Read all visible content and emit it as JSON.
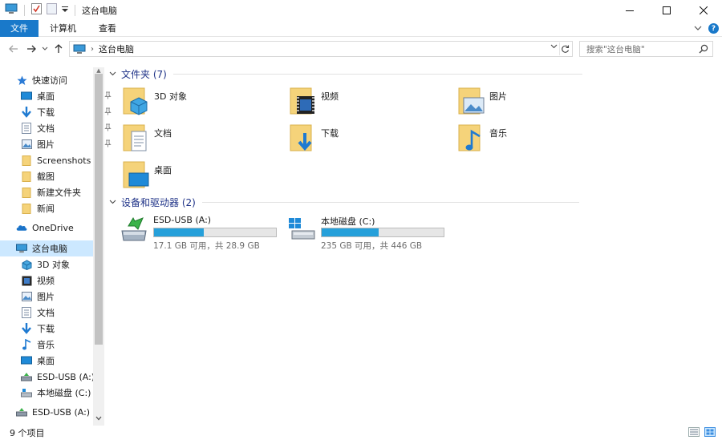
{
  "window": {
    "title": "这台电脑"
  },
  "ribbon": {
    "tabs": [
      "文件",
      "计算机",
      "查看"
    ],
    "help": "?"
  },
  "address": {
    "path": "这台电脑",
    "search_placeholder": "搜索\"这台电脑\""
  },
  "sidebar": {
    "quick_access": "快速访问",
    "items": [
      {
        "label": "桌面",
        "icon": "desktop-icon",
        "pinned": true
      },
      {
        "label": "下载",
        "icon": "download-icon",
        "pinned": true
      },
      {
        "label": "文档",
        "icon": "document-icon",
        "pinned": true
      },
      {
        "label": "图片",
        "icon": "picture-icon",
        "pinned": true
      },
      {
        "label": "Screenshots",
        "icon": "folder-icon",
        "pinned": false
      },
      {
        "label": "截图",
        "icon": "folder-icon",
        "pinned": false
      },
      {
        "label": "新建文件夹",
        "icon": "folder-icon",
        "pinned": false
      },
      {
        "label": "新闻",
        "icon": "folder-icon",
        "pinned": false
      }
    ],
    "onedrive": "OneDrive",
    "this_pc": "这台电脑",
    "pc_items": [
      {
        "label": "3D 对象",
        "icon": "3d-objects-icon"
      },
      {
        "label": "视频",
        "icon": "video-icon"
      },
      {
        "label": "图片",
        "icon": "picture-icon"
      },
      {
        "label": "文档",
        "icon": "document-icon"
      },
      {
        "label": "下载",
        "icon": "download-icon"
      },
      {
        "label": "音乐",
        "icon": "music-icon"
      },
      {
        "label": "桌面",
        "icon": "desktop-icon"
      },
      {
        "label": "ESD-USB (A:)",
        "icon": "usb-drive-icon"
      },
      {
        "label": "本地磁盘 (C:)",
        "icon": "local-disk-icon"
      }
    ],
    "usb_root": "ESD-USB (A:)"
  },
  "main": {
    "folders_header": "文件夹 (7)",
    "folders": [
      {
        "label": "3D 对象",
        "icon": "3d-objects-folder-icon"
      },
      {
        "label": "视频",
        "icon": "video-folder-icon"
      },
      {
        "label": "图片",
        "icon": "picture-folder-icon"
      },
      {
        "label": "文档",
        "icon": "document-folder-icon"
      },
      {
        "label": "下载",
        "icon": "download-folder-icon"
      },
      {
        "label": "音乐",
        "icon": "music-folder-icon"
      },
      {
        "label": "桌面",
        "icon": "desktop-folder-icon"
      }
    ],
    "drives_header": "设备和驱动器 (2)",
    "drives": [
      {
        "label": "ESD-USB (A:)",
        "info": "17.1 GB 可用，共 28.9 GB",
        "used_fraction": 0.41,
        "icon": "usb-drive-icon"
      },
      {
        "label": "本地磁盘 (C:)",
        "info": "235 GB 可用，共 446 GB",
        "used_fraction": 0.47,
        "icon": "windows-disk-icon"
      }
    ]
  },
  "status": {
    "count": "9 个项目"
  },
  "colors": {
    "accent": "#1979ca",
    "selected": "#cce8ff",
    "header_text": "#1e3287",
    "progress": "#26a0da",
    "folder": "#f3c969"
  }
}
